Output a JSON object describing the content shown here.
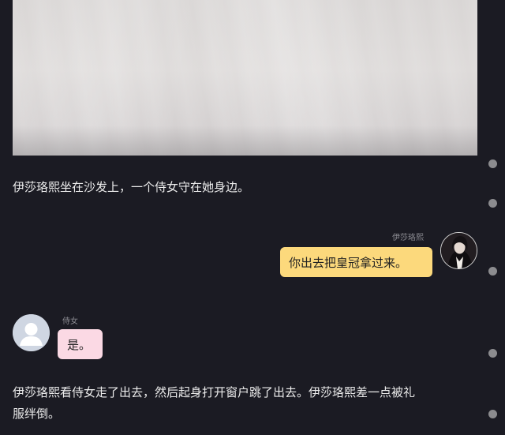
{
  "narration": {
    "line1": "伊莎珞熙坐在沙发上，一个侍女守在她身边。",
    "line2a": "伊莎珞熙看侍女走了出去，然后起身打开窗户跳了出去。伊莎珞熙差一点被礼",
    "line2b": "服绊倒。"
  },
  "messages": [
    {
      "side": "right",
      "sender": "伊莎珞熙",
      "text": "你出去把皇冠拿过来。",
      "bubble_color": "#fcd97c"
    },
    {
      "side": "left",
      "sender": "侍女",
      "text": "是。",
      "bubble_color": "#fbd9e4"
    }
  ],
  "colors": {
    "background": "#1b1b23",
    "text": "#ededed",
    "sender_label": "#8b8b92",
    "scroll_dot": "#8c8c8f"
  },
  "icons": {
    "photo": "white-dress-photo",
    "avatar_right": "character-avatar",
    "avatar_left": "default-user-avatar"
  }
}
